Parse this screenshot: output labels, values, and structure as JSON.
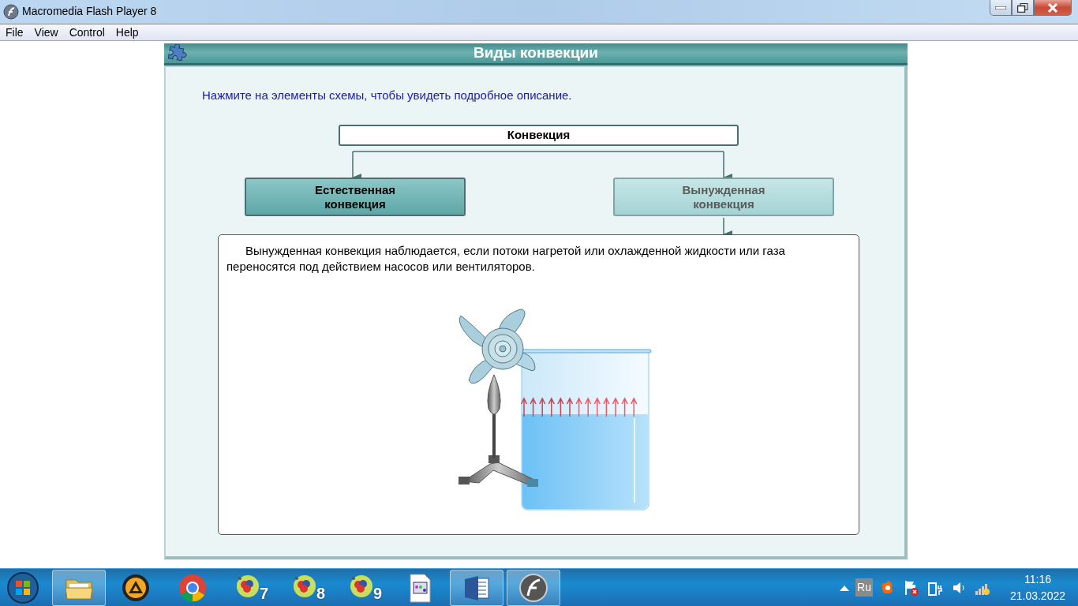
{
  "window": {
    "title": "Macromedia Flash Player 8"
  },
  "menu": [
    "File",
    "View",
    "Control",
    "Help"
  ],
  "movie": {
    "title": "Виды конвекции",
    "instruction": "Нажмите на элементы схемы, чтобы увидеть подробное описание.",
    "diagram": {
      "root": "Конвекция",
      "branches": [
        {
          "label": "Естественная\nконвекция",
          "selected": false
        },
        {
          "label": "Вынужденная\nконвекция",
          "selected": true
        }
      ],
      "description": "Вынужденная конвекция наблюдается, если потоки нагретой или охлажденной жидкости или газа переносятся под действием насосов или вентиляторов."
    }
  },
  "taskbar": {
    "items": [
      {
        "kind": "folder",
        "running": true
      },
      {
        "kind": "aimp",
        "running": false
      },
      {
        "kind": "chrome",
        "running": false
      },
      {
        "kind": "atom",
        "number": "7",
        "running": false
      },
      {
        "kind": "atom",
        "number": "8",
        "running": false
      },
      {
        "kind": "atom",
        "number": "9",
        "running": false
      },
      {
        "kind": "document",
        "running": false
      },
      {
        "kind": "word",
        "running": true
      },
      {
        "kind": "flash",
        "running": true
      }
    ],
    "language": "Ru",
    "time": "11:16",
    "date": "21.03.2022"
  }
}
